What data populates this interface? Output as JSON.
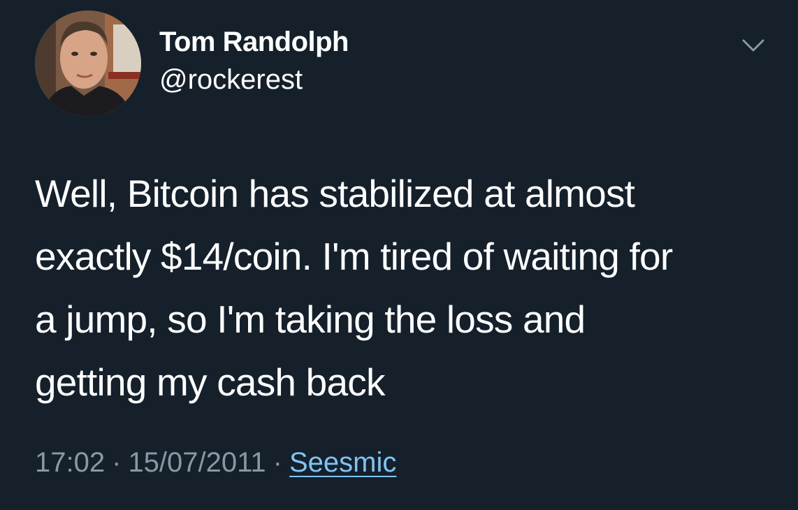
{
  "tweet": {
    "author": {
      "display_name": "Tom Randolph",
      "handle": "@rockerest",
      "avatar": "profile-photo"
    },
    "menu_icon": "chevron-down-icon",
    "text": "Well, Bitcoin has stabilized at almost\nexactly $14/coin.  I'm tired of waiting for\na jump, so I'm taking the loss and\ngetting my cash back",
    "time": "17:02",
    "date": "15/07/2011",
    "separator": "·",
    "source": "Seesmic"
  },
  "colors": {
    "background": "#15202b",
    "text": "#ffffff",
    "muted": "#8899a6",
    "link": "#7fc4f2"
  }
}
